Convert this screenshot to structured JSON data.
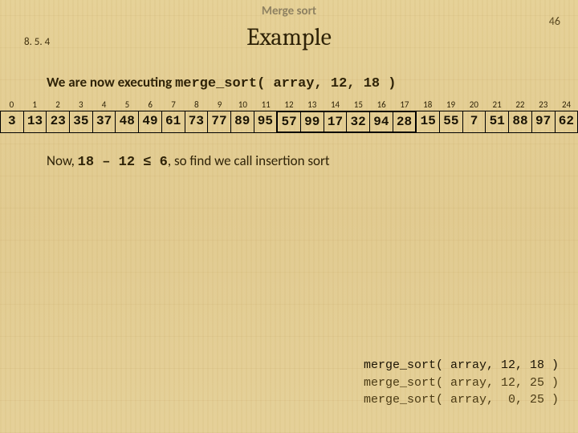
{
  "header": {
    "topic": "Merge sort"
  },
  "page_number": "46",
  "section_number": "8. 5. 4",
  "title": "Example",
  "line1_prefix": "We are now executing ",
  "line1_code": "merge_sort( array, 12, 18 )",
  "indices": [
    "0",
    "1",
    "2",
    "3",
    "4",
    "5",
    "6",
    "7",
    "8",
    "9",
    "10",
    "11",
    "12",
    "13",
    "14",
    "15",
    "16",
    "17",
    "18",
    "19",
    "20",
    "21",
    "22",
    "23",
    "24"
  ],
  "values": [
    "3",
    "13",
    "23",
    "35",
    "37",
    "48",
    "49",
    "61",
    "73",
    "77",
    "89",
    "95",
    "57",
    "99",
    "17",
    "32",
    "94",
    "28",
    "15",
    "55",
    "7",
    "51",
    "88",
    "97",
    "62"
  ],
  "highlight_start": 12,
  "highlight_end_exclusive": 18,
  "line2_a": "Now, ",
  "line2_math": "18 – 12 ≤ 6",
  "line2_b": ", so find we call insertion sort",
  "stack": [
    "merge_sort( array, 12, 18 )",
    "merge_sort( array, 12, 25 )",
    "merge_sort( array,  0, 25 )"
  ]
}
